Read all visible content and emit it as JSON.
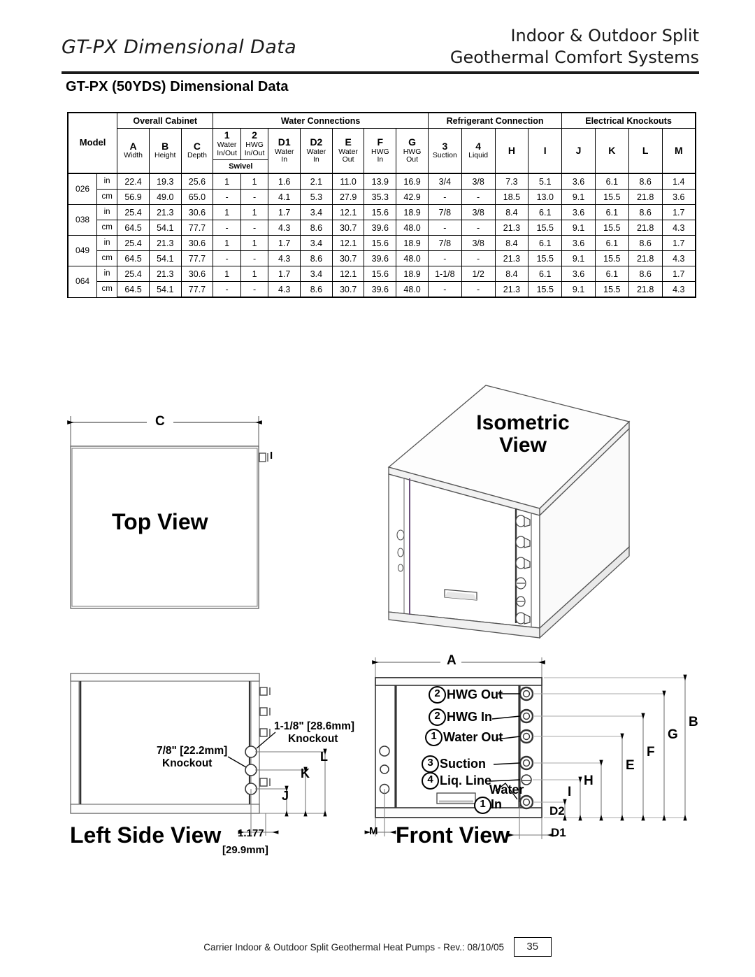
{
  "header": {
    "left_title": "GT-PX Dimensional Data",
    "right_line1": "Indoor & Outdoor Split",
    "right_line2": "Geothermal Comfort Systems"
  },
  "section_title": "GT-PX (50YDS) Dimensional Data",
  "table": {
    "groups": [
      {
        "label": "Overall Cabinet",
        "span": 3
      },
      {
        "label": "Water Connections",
        "span": 7
      },
      {
        "label": "Refrigerant Connection",
        "span": 4
      },
      {
        "label": "Electrical Knockouts",
        "span": 4
      }
    ],
    "model_header": "Model",
    "columns": [
      {
        "code": "A",
        "sub": "Width"
      },
      {
        "code": "B",
        "sub": "Height"
      },
      {
        "code": "C",
        "sub": "Depth"
      },
      {
        "code": "1",
        "sub": "Water In/Out"
      },
      {
        "code": "2",
        "sub": "HWG In/Out"
      },
      {
        "code": "D1",
        "sub": "Water In"
      },
      {
        "code": "D2",
        "sub": "Water In"
      },
      {
        "code": "E",
        "sub": "Water Out"
      },
      {
        "code": "F",
        "sub": "HWG In"
      },
      {
        "code": "G",
        "sub": "HWG Out"
      },
      {
        "code": "3",
        "sub": "Suction"
      },
      {
        "code": "4",
        "sub": "Liquid"
      },
      {
        "code": "H",
        "sub": ""
      },
      {
        "code": "I",
        "sub": ""
      },
      {
        "code": "J",
        "sub": ""
      },
      {
        "code": "K",
        "sub": ""
      },
      {
        "code": "L",
        "sub": ""
      },
      {
        "code": "M",
        "sub": ""
      }
    ],
    "swivel_label": "Swivel",
    "units": [
      "in",
      "cm"
    ],
    "rows": [
      {
        "model": "026",
        "in": [
          "22.4",
          "19.3",
          "25.6",
          "1",
          "1",
          "1.6",
          "2.1",
          "11.0",
          "13.9",
          "16.9",
          "3/4",
          "3/8",
          "7.3",
          "5.1",
          "3.6",
          "6.1",
          "8.6",
          "1.4"
        ],
        "cm": [
          "56.9",
          "49.0",
          "65.0",
          "-",
          "-",
          "4.1",
          "5.3",
          "27.9",
          "35.3",
          "42.9",
          "-",
          "-",
          "18.5",
          "13.0",
          "9.1",
          "15.5",
          "21.8",
          "3.6"
        ]
      },
      {
        "model": "038",
        "in": [
          "25.4",
          "21.3",
          "30.6",
          "1",
          "1",
          "1.7",
          "3.4",
          "12.1",
          "15.6",
          "18.9",
          "7/8",
          "3/8",
          "8.4",
          "6.1",
          "3.6",
          "6.1",
          "8.6",
          "1.7"
        ],
        "cm": [
          "64.5",
          "54.1",
          "77.7",
          "-",
          "-",
          "4.3",
          "8.6",
          "30.7",
          "39.6",
          "48.0",
          "-",
          "-",
          "21.3",
          "15.5",
          "9.1",
          "15.5",
          "21.8",
          "4.3"
        ]
      },
      {
        "model": "049",
        "in": [
          "25.4",
          "21.3",
          "30.6",
          "1",
          "1",
          "1.7",
          "3.4",
          "12.1",
          "15.6",
          "18.9",
          "7/8",
          "3/8",
          "8.4",
          "6.1",
          "3.6",
          "6.1",
          "8.6",
          "1.7"
        ],
        "cm": [
          "64.5",
          "54.1",
          "77.7",
          "-",
          "-",
          "4.3",
          "8.6",
          "30.7",
          "39.6",
          "48.0",
          "-",
          "-",
          "21.3",
          "15.5",
          "9.1",
          "15.5",
          "21.8",
          "4.3"
        ]
      },
      {
        "model": "064",
        "in": [
          "25.4",
          "21.3",
          "30.6",
          "1",
          "1",
          "1.7",
          "3.4",
          "12.1",
          "15.6",
          "18.9",
          "1-1/8",
          "1/2",
          "8.4",
          "6.1",
          "3.6",
          "6.1",
          "8.6",
          "1.7"
        ],
        "cm": [
          "64.5",
          "54.1",
          "77.7",
          "-",
          "-",
          "4.3",
          "8.6",
          "30.7",
          "39.6",
          "48.0",
          "-",
          "-",
          "21.3",
          "15.5",
          "9.1",
          "15.5",
          "21.8",
          "4.3"
        ]
      }
    ]
  },
  "drawings": {
    "top_view": {
      "title": "Top View",
      "dim_c": "C",
      "dim_i": "I"
    },
    "isometric": {
      "title_line1": "Isometric",
      "title_line2": "View"
    },
    "left_side_view": {
      "title": "Left Side View",
      "callout_large": "1-1/8\" [28.6mm]",
      "callout_large_2": "Knockout",
      "callout_small": "7/8\" [22.2mm]",
      "callout_small_2": "Knockout",
      "dim_j": "J",
      "dim_k": "K",
      "dim_l": "L",
      "dim_offset_1": "1.177",
      "dim_offset_2": "[29.9mm]"
    },
    "front_view": {
      "title": "Front View",
      "dim_a": "A",
      "dim_b": "B",
      "dim_g": "G",
      "dim_f": "F",
      "dim_e": "E",
      "dim_h": "H",
      "dim_i": "I",
      "dim_d1": "D1",
      "dim_d2": "D2",
      "dim_m": "M",
      "ports": [
        {
          "num": "2",
          "label": "HWG Out"
        },
        {
          "num": "2",
          "label": "HWG In"
        },
        {
          "num": "1",
          "label": "Water Out"
        },
        {
          "num": "3",
          "label": "Suction"
        },
        {
          "num": "4",
          "label": "Liq. Line"
        },
        {
          "num": "1",
          "label_line1": "Water",
          "label_line2": "In"
        }
      ]
    }
  },
  "footer": {
    "text": "Carrier Indoor & Outdoor Split Geothermal Heat Pumps - Rev.: 08/10/05",
    "page": "35"
  }
}
